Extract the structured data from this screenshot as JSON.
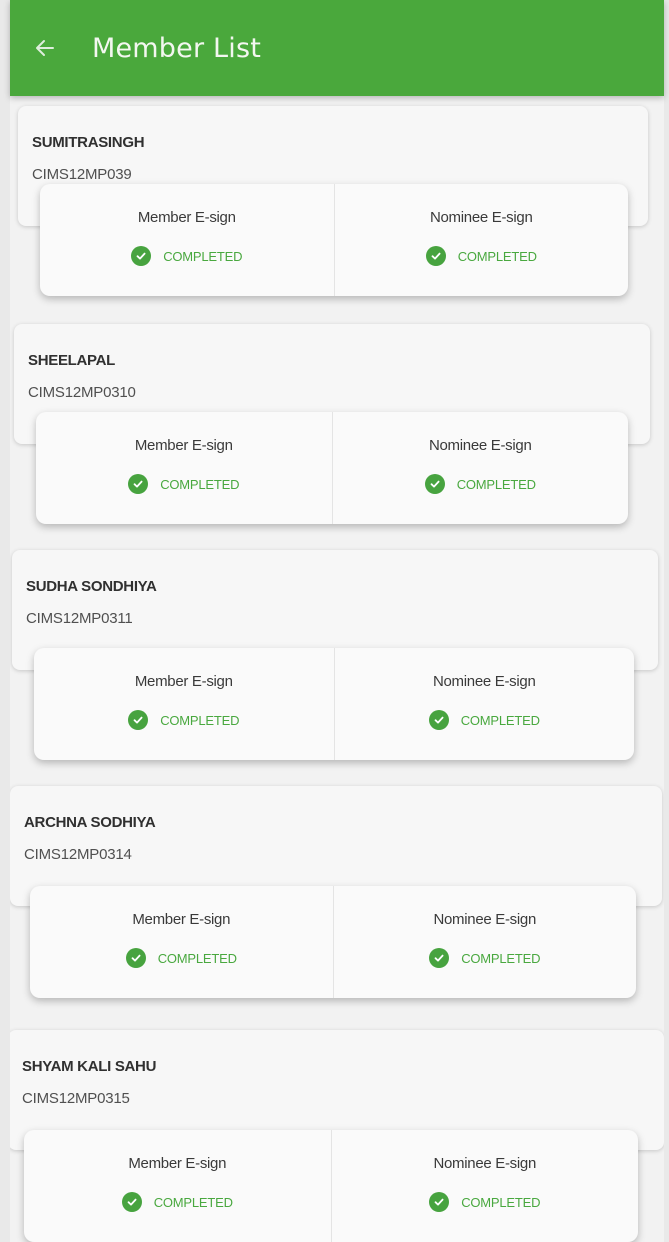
{
  "header": {
    "title": "Member List",
    "accent_color": "#4aa83c",
    "back_icon": "arrow-left-icon"
  },
  "members": [
    {
      "name": "SUMITRASINGH",
      "id": "CIMS12MP039",
      "member_esign_label": "Member E-sign",
      "member_esign_status": "COMPLETED",
      "nominee_esign_label": "Nominee E-sign",
      "nominee_esign_status": "COMPLETED"
    },
    {
      "name": "SHEELAPAL",
      "id": "CIMS12MP0310",
      "member_esign_label": "Member E-sign",
      "member_esign_status": "COMPLETED",
      "nominee_esign_label": "Nominee E-sign",
      "nominee_esign_status": "COMPLETED"
    },
    {
      "name": "SUDHA SONDHIYA",
      "id": "CIMS12MP0311",
      "member_esign_label": "Member E-sign",
      "member_esign_status": "COMPLETED",
      "nominee_esign_label": "Nominee E-sign",
      "nominee_esign_status": "COMPLETED"
    },
    {
      "name": "ARCHNA SODHIYA",
      "id": "CIMS12MP0314",
      "member_esign_label": "Member E-sign",
      "member_esign_status": "COMPLETED",
      "nominee_esign_label": "Nominee E-sign",
      "nominee_esign_status": "COMPLETED"
    },
    {
      "name": "SHYAM KALI SAHU",
      "id": "CIMS12MP0315",
      "member_esign_label": "Member E-sign",
      "member_esign_status": "COMPLETED",
      "nominee_esign_label": "Nominee E-sign",
      "nominee_esign_status": "COMPLETED"
    }
  ],
  "status_color": "#49a83f",
  "status_icon": "check-circle-icon"
}
